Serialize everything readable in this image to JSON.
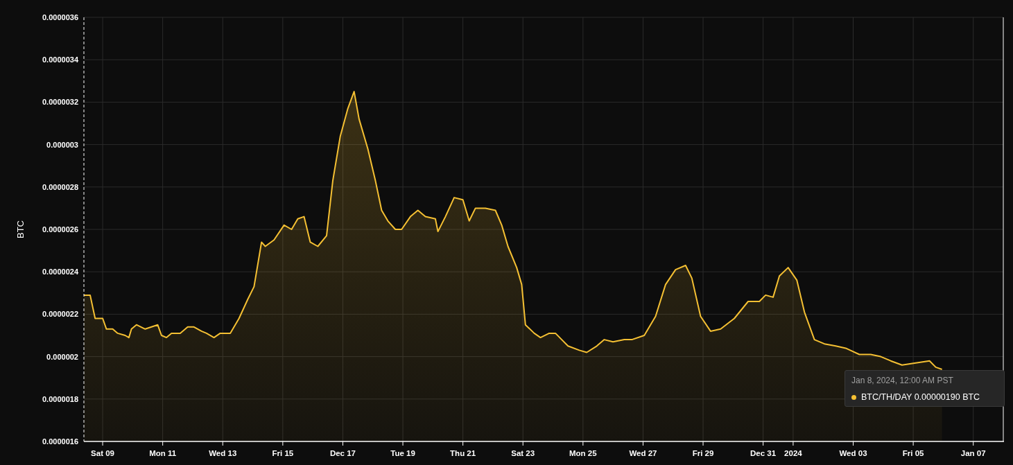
{
  "chart_data": {
    "type": "area",
    "ylabel": "BTC",
    "grid": true,
    "xlim": [
      "2023-12-08T09:00",
      "2024-01-08T00:00"
    ],
    "ylim": [
      1.6e-06,
      3.6e-06
    ],
    "xticks": [
      {
        "value": "2023-12-09T00:00",
        "label": "Sat 09"
      },
      {
        "value": "2023-12-11T00:00",
        "label": "Mon 11"
      },
      {
        "value": "2023-12-13T00:00",
        "label": "Wed 13"
      },
      {
        "value": "2023-12-15T00:00",
        "label": "Fri 15"
      },
      {
        "value": "2023-12-17T00:00",
        "label": "Dec 17"
      },
      {
        "value": "2023-12-19T00:00",
        "label": "Tue 19"
      },
      {
        "value": "2023-12-21T00:00",
        "label": "Thu 21"
      },
      {
        "value": "2023-12-23T00:00",
        "label": "Sat 23"
      },
      {
        "value": "2023-12-25T00:00",
        "label": "Mon 25"
      },
      {
        "value": "2023-12-27T00:00",
        "label": "Wed 27"
      },
      {
        "value": "2023-12-29T00:00",
        "label": "Fri 29"
      },
      {
        "value": "2023-12-31T00:00",
        "label": "Dec 31"
      },
      {
        "value": "2024-01-01T00:00",
        "label": "2024"
      },
      {
        "value": "2024-01-03T00:00",
        "label": "Wed 03"
      },
      {
        "value": "2024-01-05T00:00",
        "label": "Fri 05"
      },
      {
        "value": "2024-01-07T00:00",
        "label": "Jan 07"
      }
    ],
    "yticks": [
      {
        "value": 1.6e-06,
        "label": "0.0000016"
      },
      {
        "value": 1.8e-06,
        "label": "0.0000018"
      },
      {
        "value": 2e-06,
        "label": "0.000002"
      },
      {
        "value": 2.2e-06,
        "label": "0.0000022"
      },
      {
        "value": 2.4e-06,
        "label": "0.0000024"
      },
      {
        "value": 2.6e-06,
        "label": "0.0000026"
      },
      {
        "value": 2.8e-06,
        "label": "0.0000028"
      },
      {
        "value": 3e-06,
        "label": "0.000003"
      },
      {
        "value": 3.2e-06,
        "label": "0.0000032"
      },
      {
        "value": 3.4e-06,
        "label": "0.0000034"
      },
      {
        "value": 3.6e-06,
        "label": "0.0000036"
      }
    ],
    "x": [
      "2023-12-08T09:00",
      "2023-12-08T14:00",
      "2023-12-08T18:00",
      "2023-12-09T00:00",
      "2023-12-09T03:00",
      "2023-12-09T08:00",
      "2023-12-09T12:00",
      "2023-12-09T18:00",
      "2023-12-09T21:00",
      "2023-12-09T23:00",
      "2023-12-10T03:00",
      "2023-12-10T10:00",
      "2023-12-10T20:00",
      "2023-12-10T23:00",
      "2023-12-11T03:00",
      "2023-12-11T07:00",
      "2023-12-11T14:00",
      "2023-12-11T20:00",
      "2023-12-12T01:00",
      "2023-12-12T07:00",
      "2023-12-12T11:00",
      "2023-12-12T17:00",
      "2023-12-12T22:00",
      "2023-12-13T06:00",
      "2023-12-13T13:00",
      "2023-12-13T20:00",
      "2023-12-14T01:00",
      "2023-12-14T07:00",
      "2023-12-14T10:00",
      "2023-12-14T17:00",
      "2023-12-15T01:00",
      "2023-12-15T07:00",
      "2023-12-15T12:00",
      "2023-12-15T17:00",
      "2023-12-15T22:00",
      "2023-12-16T04:00",
      "2023-12-16T11:00",
      "2023-12-16T16:00",
      "2023-12-16T22:00",
      "2023-12-17T04:00",
      "2023-12-17T09:00",
      "2023-12-17T13:00",
      "2023-12-17T20:00",
      "2023-12-18T02:00",
      "2023-12-18T07:00",
      "2023-12-18T12:00",
      "2023-12-18T18:00",
      "2023-12-18T23:00",
      "2023-12-19T06:00",
      "2023-12-19T12:00",
      "2023-12-19T18:00",
      "2023-12-20T02:00",
      "2023-12-20T04:00",
      "2023-12-20T10:00",
      "2023-12-20T17:00",
      "2023-12-21T00:00",
      "2023-12-21T05:00",
      "2023-12-21T10:00",
      "2023-12-21T18:00",
      "2023-12-22T02:00",
      "2023-12-22T07:00",
      "2023-12-22T12:00",
      "2023-12-22T19:00",
      "2023-12-22T23:00",
      "2023-12-23T02:00",
      "2023-12-23T09:00",
      "2023-12-23T14:00",
      "2023-12-23T21:00",
      "2023-12-24T02:00",
      "2023-12-24T07:00",
      "2023-12-24T12:00",
      "2023-12-24T21:00",
      "2023-12-25T03:00",
      "2023-12-25T11:00",
      "2023-12-25T17:00",
      "2023-12-26T00:00",
      "2023-12-26T09:00",
      "2023-12-26T15:00",
      "2023-12-27T01:00",
      "2023-12-27T10:00",
      "2023-12-27T18:00",
      "2023-12-28T02:00",
      "2023-12-28T10:00",
      "2023-12-28T15:00",
      "2023-12-28T22:00",
      "2023-12-29T06:00",
      "2023-12-29T14:00",
      "2023-12-30T01:00",
      "2023-12-30T12:00",
      "2023-12-30T21:00",
      "2023-12-31T02:00",
      "2023-12-31T08:00",
      "2023-12-31T13:00",
      "2023-12-31T20:00",
      "2024-01-01T03:00",
      "2024-01-01T09:00",
      "2024-01-01T17:00",
      "2024-01-02T01:00",
      "2024-01-02T10:00",
      "2024-01-02T18:00",
      "2024-01-03T05:00",
      "2024-01-03T14:00",
      "2024-01-03T22:00",
      "2024-01-04T06:00",
      "2024-01-04T15:00",
      "2024-01-05T02:00",
      "2024-01-05T13:00",
      "2024-01-05T18:00",
      "2024-01-05T23:00"
    ],
    "series": [
      {
        "name": "BTC/TH/DAY",
        "color": "#f5c033",
        "values": [
          2.29e-06,
          2.29e-06,
          2.18e-06,
          2.18e-06,
          2.13e-06,
          2.13e-06,
          2.11e-06,
          2.1e-06,
          2.09e-06,
          2.13e-06,
          2.15e-06,
          2.13e-06,
          2.15e-06,
          2.1e-06,
          2.09e-06,
          2.11e-06,
          2.11e-06,
          2.14e-06,
          2.14e-06,
          2.12e-06,
          2.11e-06,
          2.09e-06,
          2.11e-06,
          2.11e-06,
          2.18e-06,
          2.27e-06,
          2.33e-06,
          2.54e-06,
          2.52e-06,
          2.55e-06,
          2.62e-06,
          2.6e-06,
          2.65e-06,
          2.66e-06,
          2.54e-06,
          2.52e-06,
          2.57e-06,
          2.83e-06,
          3.04e-06,
          3.17e-06,
          3.25e-06,
          3.12e-06,
          2.98e-06,
          2.83e-06,
          2.69e-06,
          2.64e-06,
          2.6e-06,
          2.6e-06,
          2.66e-06,
          2.69e-06,
          2.66e-06,
          2.65e-06,
          2.59e-06,
          2.66e-06,
          2.75e-06,
          2.74e-06,
          2.64e-06,
          2.7e-06,
          2.7e-06,
          2.69e-06,
          2.62e-06,
          2.52e-06,
          2.42e-06,
          2.34e-06,
          2.15e-06,
          2.11e-06,
          2.09e-06,
          2.11e-06,
          2.11e-06,
          2.08e-06,
          2.05e-06,
          2.03e-06,
          2.02e-06,
          2.05e-06,
          2.08e-06,
          2.07e-06,
          2.08e-06,
          2.08e-06,
          2.1e-06,
          2.19e-06,
          2.34e-06,
          2.41e-06,
          2.43e-06,
          2.37e-06,
          2.19e-06,
          2.12e-06,
          2.13e-06,
          2.18e-06,
          2.26e-06,
          2.26e-06,
          2.29e-06,
          2.28e-06,
          2.38e-06,
          2.42e-06,
          2.36e-06,
          2.21e-06,
          2.08e-06,
          2.06e-06,
          2.05e-06,
          2.04e-06,
          2.01e-06,
          2.01e-06,
          2e-06,
          1.98e-06,
          1.96e-06,
          1.97e-06,
          1.98e-06,
          1.95e-06,
          1.94e-06
        ]
      }
    ]
  },
  "tooltip": {
    "title": "Jan 8, 2024, 12:00 AM PST",
    "value": "0.00000190 BTC"
  }
}
